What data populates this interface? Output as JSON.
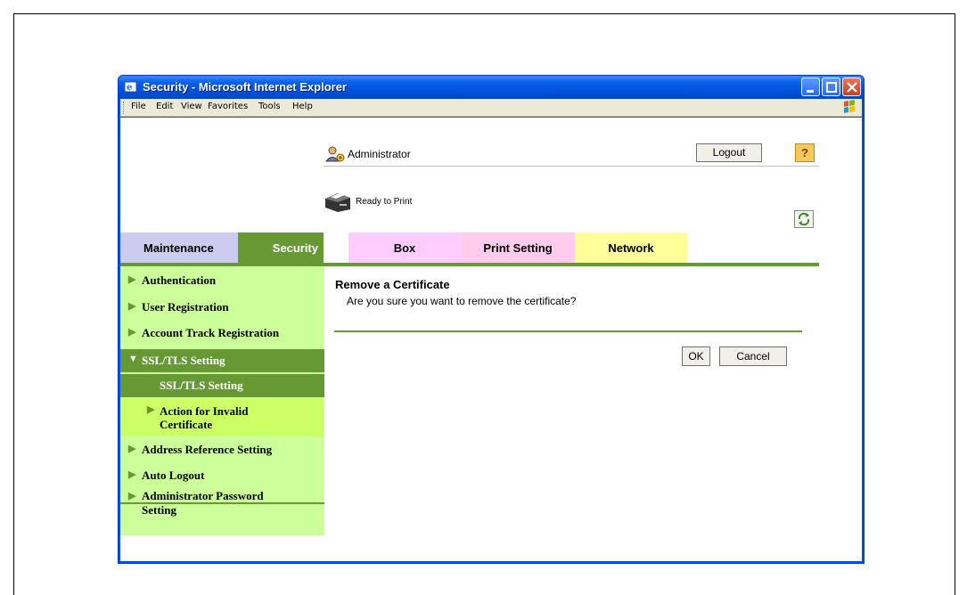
{
  "window": {
    "title": "Security - Microsoft Internet Explorer"
  },
  "menubar": {
    "items": [
      "File",
      "Edit",
      "View",
      "Favorites",
      "Tools",
      "Help"
    ]
  },
  "header": {
    "user_label": "Administrator",
    "logout_label": "Logout",
    "help_label": "?",
    "status_text": "Ready to Print"
  },
  "tabs": [
    {
      "label": "Maintenance"
    },
    {
      "label": "Security"
    },
    {
      "label": "Box"
    },
    {
      "label": "Print Setting"
    },
    {
      "label": "Network"
    }
  ],
  "sidebar": {
    "items": [
      {
        "label": "Authentication"
      },
      {
        "label": "User Registration"
      },
      {
        "label": "Account Track Registration"
      },
      {
        "label": "SSL/TLS Setting"
      },
      {
        "label": "SSL/TLS Setting"
      },
      {
        "label": "Action for Invalid Certificate"
      },
      {
        "label": "Address Reference Setting"
      },
      {
        "label": "Auto Logout"
      },
      {
        "label": "Administrator Password Setting"
      }
    ]
  },
  "main": {
    "title": "Remove a Certificate",
    "message": "Are you sure you want to remove the certificate?",
    "ok_label": "OK",
    "cancel_label": "Cancel"
  },
  "colors": {
    "accent_green": "#669933",
    "sidebar_bg": "#ccff99",
    "tab_maintenance": "#ccccee",
    "tab_box": "#ffccff",
    "tab_print": "#ffccee",
    "tab_network": "#ffff99",
    "titlebar_blue": "#0054e3"
  },
  "icons": {
    "window": "ie-icon",
    "user": "administrator-icon",
    "printer": "printer-icon",
    "refresh": "refresh-icon"
  }
}
